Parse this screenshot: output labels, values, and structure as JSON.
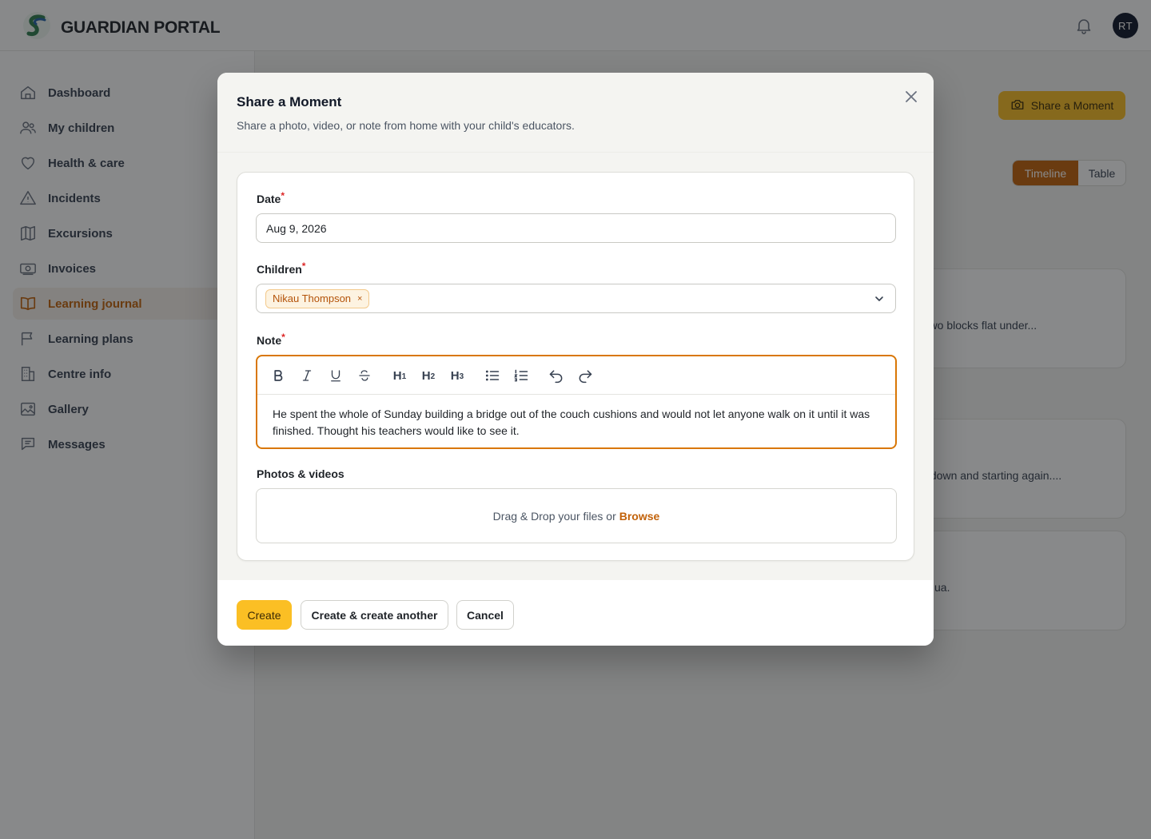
{
  "app": {
    "name": "GUARDIAN PORTAL",
    "avatar_initials": "RT",
    "accent": "#c2620a",
    "primary": "#fbbf24"
  },
  "sidebar": {
    "items": [
      {
        "label": "Dashboard",
        "icon": "home-icon"
      },
      {
        "label": "My children",
        "icon": "users-icon"
      },
      {
        "label": "Health & care",
        "icon": "heart-icon"
      },
      {
        "label": "Incidents",
        "icon": "warning-icon"
      },
      {
        "label": "Excursions",
        "icon": "map-icon"
      },
      {
        "label": "Invoices",
        "icon": "banknote-icon"
      },
      {
        "label": "Learning journal",
        "icon": "book-icon",
        "active": true
      },
      {
        "label": "Learning plans",
        "icon": "flag-icon"
      },
      {
        "label": "Centre info",
        "icon": "building-icon"
      },
      {
        "label": "Gallery",
        "icon": "image-icon"
      },
      {
        "label": "Messages",
        "icon": "chat-icon"
      }
    ]
  },
  "main": {
    "share_button": "Share a Moment",
    "view_toggle": {
      "active": "Timeline",
      "inactive": "Table"
    },
    "cards": [
      {
        "snippet": "d two blocks flat under..."
      },
      {
        "snippet": "k down and starting again...."
      },
      {
        "snippet": "ua."
      }
    ]
  },
  "modal": {
    "title": "Share a Moment",
    "subtitle": "Share a photo, video, or note from home with your child's educators.",
    "date": {
      "label": "Date",
      "required": "*",
      "value": "Aug 9, 2026"
    },
    "children": {
      "label": "Children",
      "required": "*",
      "selected": [
        "Nikau Thompson"
      ],
      "remove_glyph": "×"
    },
    "note": {
      "label": "Note",
      "required": "*",
      "toolbar": {
        "bold": "B",
        "h1": "H",
        "h2": "H",
        "h3": "H",
        "h1_sub": "1",
        "h2_sub": "2",
        "h3_sub": "3"
      },
      "value": "He spent the whole of Sunday building a bridge out of the couch cushions and would not let anyone walk on it until it was finished. Thought his teachers would like to see it."
    },
    "media": {
      "label": "Photos & videos",
      "prompt": "Drag & Drop your files or",
      "browse": "Browse"
    },
    "actions": {
      "create": "Create",
      "create_another": "Create & create another",
      "cancel": "Cancel"
    }
  }
}
